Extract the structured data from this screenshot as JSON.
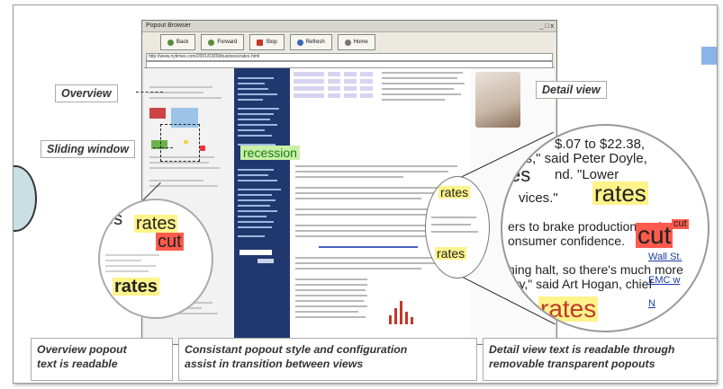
{
  "labels": {
    "overview": "Overview",
    "sliding_window": "Sliding window",
    "detail_view": "Detail view"
  },
  "captions": [
    "Overview popout\ntext is readable",
    "Consistant popout style and configuration\nassist in transition between views",
    "Detail view text is readable through\nremovable transparent popouts"
  ],
  "browser": {
    "title": "Popout Browser",
    "controls": "_ □ x",
    "toolbar": [
      "Back",
      "Forward",
      "Stop",
      "Refresh",
      "Home"
    ],
    "address": "http://www.nytimes.com/2001/03/09/business/rates.html",
    "highlight_word": "recession"
  },
  "lens_small": {
    "word1": "es",
    "word2": "rates",
    "word3": "cut",
    "word4": "rates"
  },
  "lens_mid": {
    "word": "rates",
    "word2": "rates"
  },
  "lens_big": {
    "line1": "$.07 to $22.38,",
    "line2": "ks,\" said Peter Doyle,",
    "line3": "es",
    "line3b": "nd. \"Lower",
    "word_rates": "rates",
    "line4": "vices.\"",
    "line5": "ers to brake production and",
    "word_cut_prefix": "cut",
    "line6": "onsumer confidence.",
    "word_cut": "cut",
    "line7": "hing halt, so there's much more",
    "line8": "ory,\" said Art Hogan, chief",
    "word_rates2": "rates",
    "link1": "Wall St.",
    "link2": "EMC w",
    "link3": "N"
  },
  "colors": {
    "highlight_yellow": "#fff38a",
    "highlight_red": "#ff5a4e",
    "highlight_green": "#c8f0a8",
    "nav_blue": "#20386e"
  }
}
